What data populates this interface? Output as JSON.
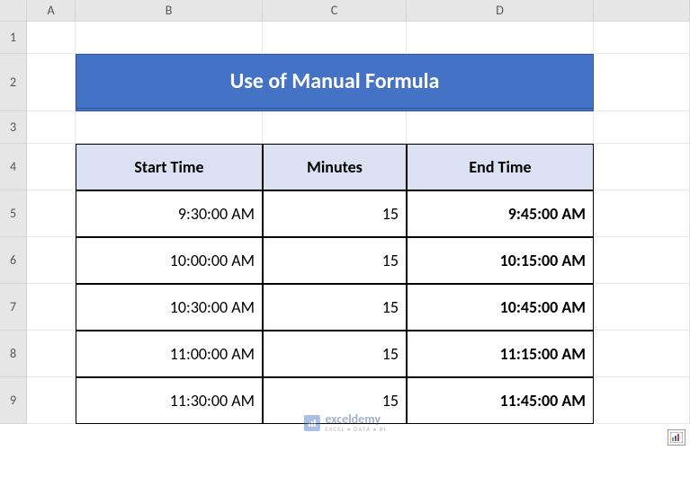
{
  "columns": [
    "A",
    "B",
    "C",
    "D"
  ],
  "rows": [
    "1",
    "2",
    "3",
    "4",
    "5",
    "6",
    "7",
    "8",
    "9"
  ],
  "title": "Use of Manual Formula",
  "headers": {
    "start_time": "Start Time",
    "minutes": "Minutes",
    "end_time": "End Time"
  },
  "data": [
    {
      "start": "9:30:00 AM",
      "minutes": "15",
      "end": "9:45:00 AM"
    },
    {
      "start": "10:00:00 AM",
      "minutes": "15",
      "end": "10:15:00 AM"
    },
    {
      "start": "10:30:00 AM",
      "minutes": "15",
      "end": "10:45:00 AM"
    },
    {
      "start": "11:00:00 AM",
      "minutes": "15",
      "end": "11:15:00 AM"
    },
    {
      "start": "11:30:00 AM",
      "minutes": "15",
      "end": "11:45:00 AM"
    }
  ],
  "watermark": {
    "name": "exceldemy",
    "tagline": "EXCEL • DATA • BI"
  },
  "chart_data": {
    "type": "table",
    "title": "Use of Manual Formula",
    "columns": [
      "Start Time",
      "Minutes",
      "End Time"
    ],
    "rows": [
      [
        "9:30:00 AM",
        15,
        "9:45:00 AM"
      ],
      [
        "10:00:00 AM",
        15,
        "10:15:00 AM"
      ],
      [
        "10:30:00 AM",
        15,
        "10:45:00 AM"
      ],
      [
        "11:00:00 AM",
        15,
        "11:15:00 AM"
      ],
      [
        "11:30:00 AM",
        15,
        "11:45:00 AM"
      ]
    ]
  }
}
